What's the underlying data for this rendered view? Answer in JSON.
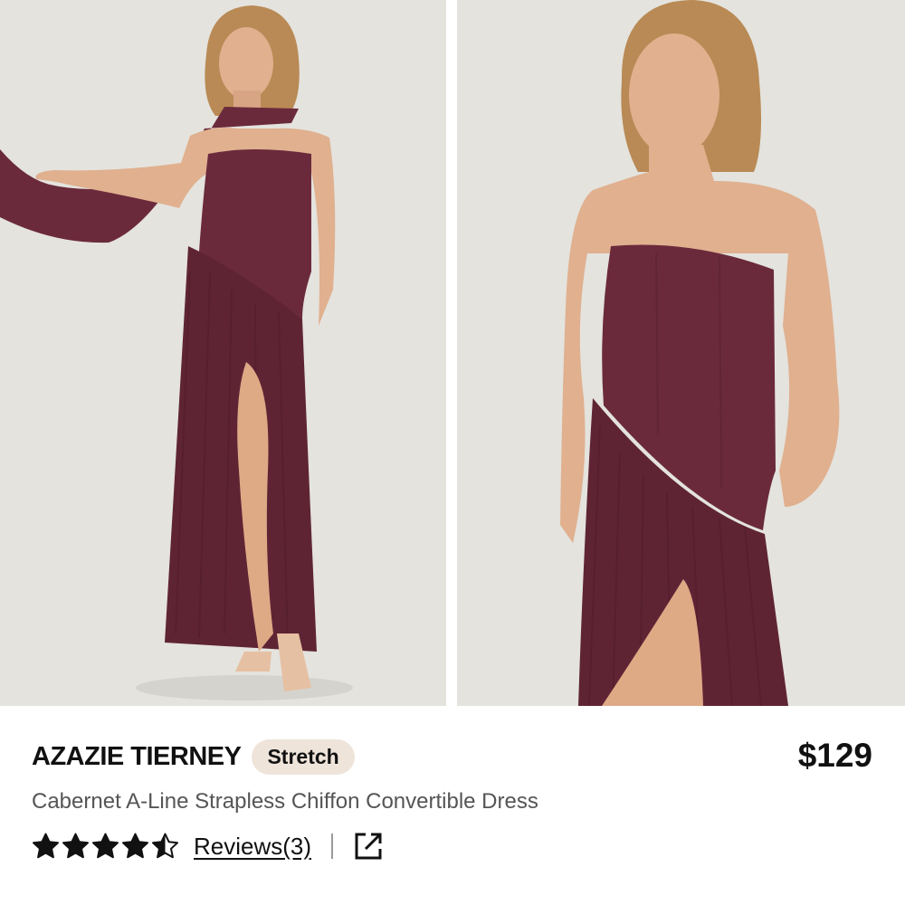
{
  "product": {
    "brand": "AZAZIE TIERNEY",
    "badge": "Stretch",
    "price": "$129",
    "name": "Cabernet A-Line Strapless Chiffon Convertible Dress",
    "rating": 4.5,
    "rating_max": 5,
    "reviews_label": "Reviews(3)"
  },
  "gallery": {
    "images": [
      {
        "icon": "model-full-length-photo"
      },
      {
        "icon": "model-close-up-photo"
      }
    ]
  },
  "colors": {
    "dress": "#6b2a3c",
    "background": "#e4e3de",
    "badge_bg": "#efe4da",
    "text": "#111111",
    "subtext": "#555555"
  },
  "icons": {
    "share": "external-link-icon",
    "star": "star-icon"
  }
}
